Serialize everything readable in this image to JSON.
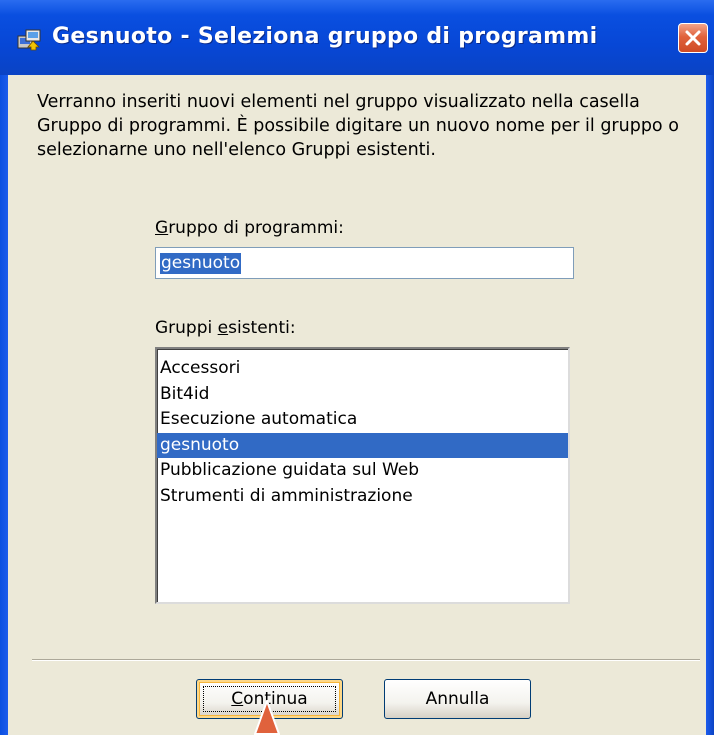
{
  "window": {
    "title": "Gesnuoto - Seleziona gruppo di programmi",
    "title_icon": "program-group-install-icon",
    "close_icon": "close-icon"
  },
  "description": "Verranno inseriti nuovi elementi nel gruppo visualizzato nella casella Gruppo di programmi. È possibile digitare un nuovo nome per il gruppo o selezionarne uno nell'elenco Gruppi esistenti.",
  "program_group": {
    "label_accel": "G",
    "label_rest": "ruppo di programmi:",
    "value": "gesnuoto"
  },
  "existing_groups": {
    "label_pre": "Gruppi ",
    "label_accel": "e",
    "label_rest": "sistenti:",
    "items": [
      {
        "label": "Accessori",
        "selected": false
      },
      {
        "label": "Bit4id",
        "selected": false
      },
      {
        "label": "Esecuzione automatica",
        "selected": false
      },
      {
        "label": "gesnuoto",
        "selected": true
      },
      {
        "label": "Pubblicazione guidata sul Web",
        "selected": false
      },
      {
        "label": "Strumenti di amministrazione",
        "selected": false
      }
    ]
  },
  "buttons": {
    "continue_accel": "C",
    "continue_rest": "ontinua",
    "cancel": "Annulla"
  },
  "colors": {
    "titlebar": "#0a4fe0",
    "selection": "#316ac5",
    "dialog_bg": "#ece9d8",
    "close_button": "#e0623c"
  }
}
